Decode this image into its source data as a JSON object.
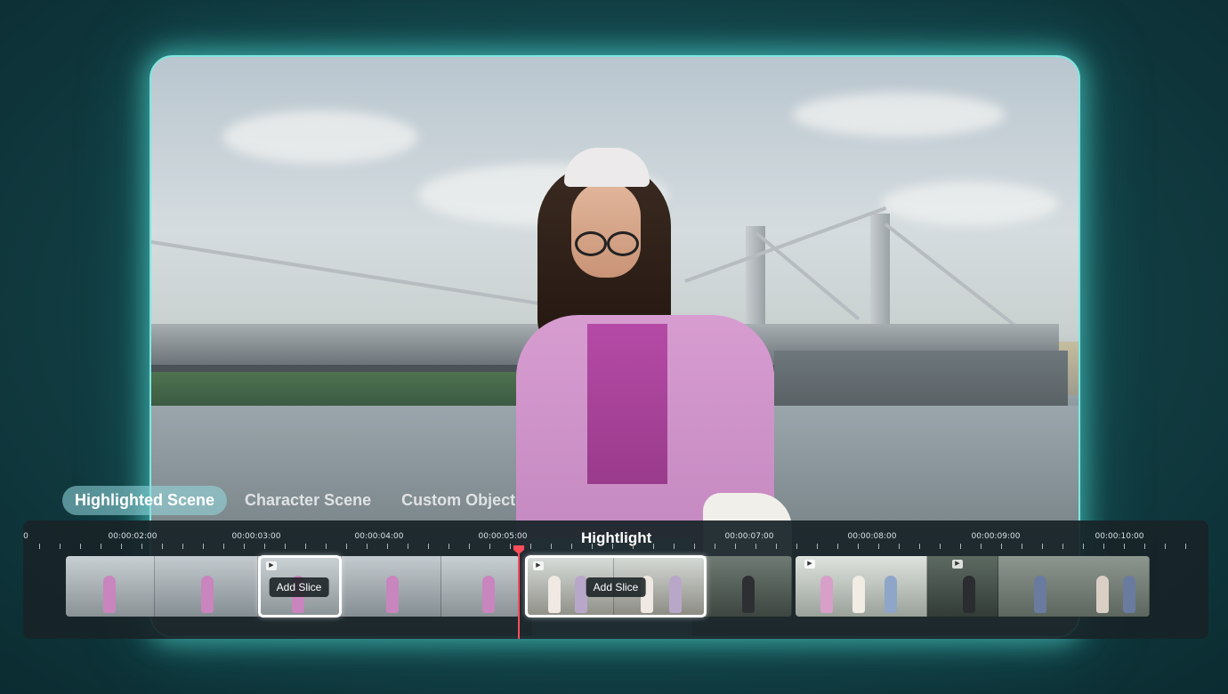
{
  "tabs": [
    {
      "label": "Highlighted Scene",
      "active": true
    },
    {
      "label": "Character Scene",
      "active": false
    },
    {
      "label": "Custom Object",
      "active": false
    }
  ],
  "timeline": {
    "ticks": [
      "00:00:02:00",
      "00:00:03:00",
      "00:00:04:00",
      "00:00:05:00",
      "00:00:07:00",
      "00:00:08:00",
      "00:00:09:00",
      "00:00:10:00"
    ],
    "start_mark": "0",
    "highlight_label": "Hightlight",
    "add_slice_label": "Add Slice",
    "playhead_color": "#ff4d5a"
  },
  "colors": {
    "accent_glow": "#7fe7e0",
    "active_tab": "#96dce1"
  },
  "icons": [
    "play-icon"
  ]
}
